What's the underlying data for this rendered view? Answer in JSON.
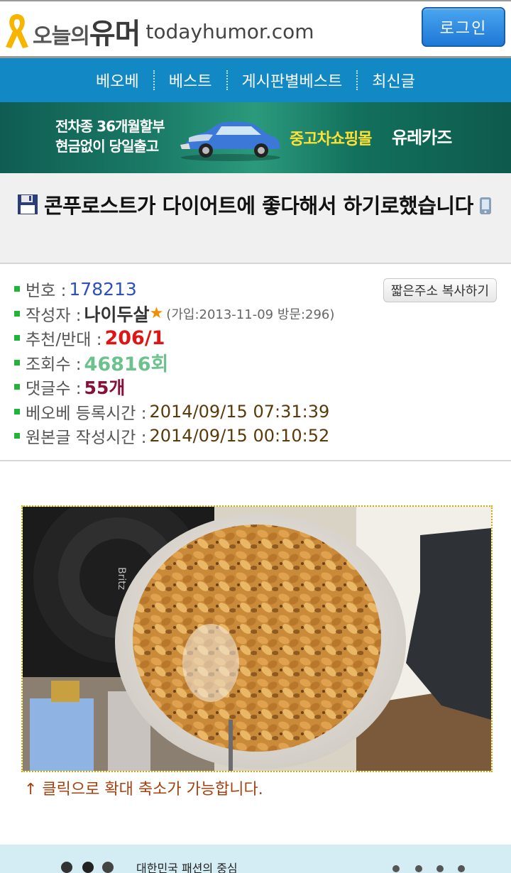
{
  "header": {
    "logo_kr_small": "오늘의",
    "logo_kr_big": "유머",
    "logo_en": "todayhumor.com",
    "login_label": "로그인"
  },
  "nav": {
    "items": [
      {
        "label": "베오베"
      },
      {
        "label": "베스트"
      },
      {
        "label": "게시판별베스트"
      },
      {
        "label": "최신글"
      }
    ]
  },
  "banner": {
    "left_line1": "전차종 36개월할부",
    "left_line2": "현금없이 당일출고",
    "right_text": "중고차쇼핑몰",
    "brand": "유레카즈"
  },
  "post": {
    "title": "콘푸로스트가 다이어트에 좋다해서 하기로했습니다",
    "copy_button": "짧은주소 복사하기",
    "fields": {
      "number_label": "번호 :",
      "number": "178213",
      "author_label": "작성자 :",
      "author": "나이두살",
      "author_star": "★",
      "author_meta": "(가입:2013-11-09 방문:296)",
      "votes_label": "추천/반대 :",
      "votes": "206/1",
      "views_label": "조회수 :",
      "views": "46816회",
      "comments_label": "댓글수 :",
      "comments": "55개",
      "best_time_label": "베오베 등록시간 :",
      "best_time": "2014/09/15 07:31:39",
      "orig_time_label": "원본글 작성시간 :",
      "orig_time": "2014/09/15 00:10:52"
    },
    "speaker_brand": "Britz",
    "zoom_hint": "↑ 클릭으로 확대 축소가 가능합니다."
  },
  "bottom_ad": {
    "text": "대한민국 패션의 중심"
  },
  "colors": {
    "nav_bg": "#1288c4",
    "login_btn": "#1e78d6",
    "bullet": "#22b33a",
    "number": "#2f4fbf",
    "votes": "#e01414",
    "views": "#6bc28c",
    "comments": "#8a0f38"
  }
}
